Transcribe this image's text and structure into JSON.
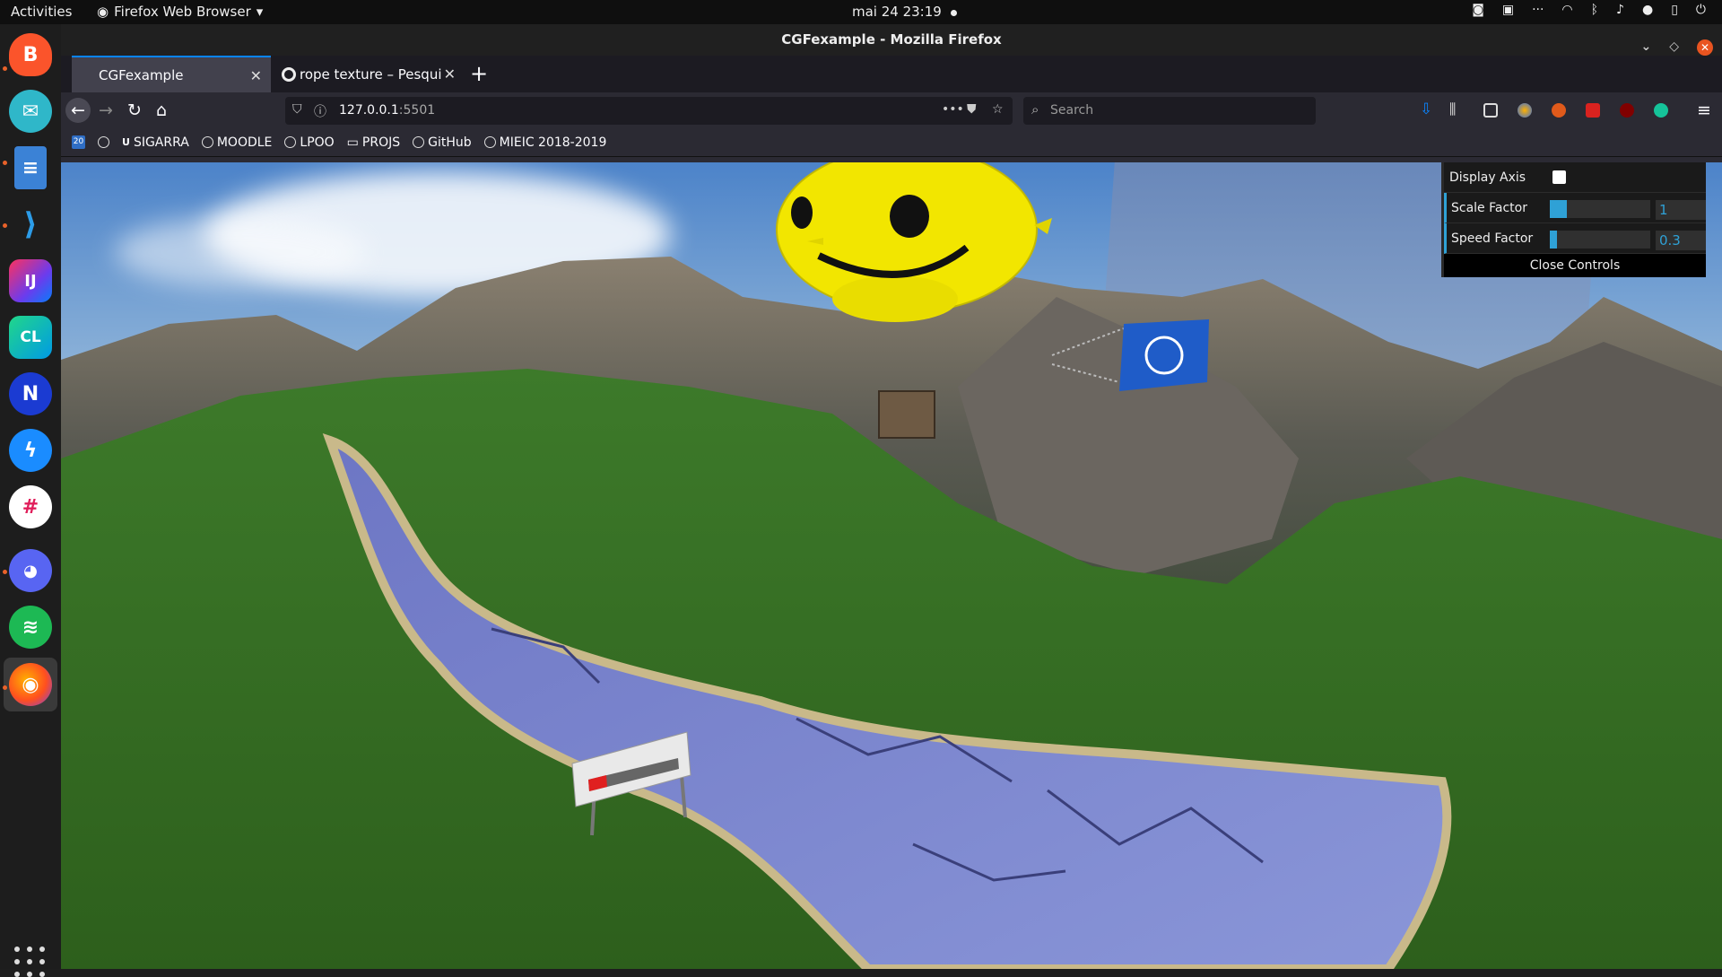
{
  "topbar": {
    "activities": "Activities",
    "app_menu": "Firefox Web Browser",
    "clock": "mai 24  23:19",
    "tray_more": "···"
  },
  "dock": {
    "items": [
      "brave-browser-beta",
      "mail",
      "text-editor",
      "vscode",
      "intellij-idea",
      "clion",
      "notion",
      "messenger",
      "slack",
      "discord",
      "spotify",
      "firefox"
    ],
    "show_apps": "show-applications"
  },
  "window": {
    "title": "CGFexample - Mozilla Firefox"
  },
  "tabs": [
    {
      "label": "CGFexample",
      "active": true
    },
    {
      "label": "rope texture – Pesquisa",
      "active": false
    }
  ],
  "navbar": {
    "url_host": "127.0.0.1",
    "url_port": ":5501",
    "url_more": "•••",
    "search_placeholder": "Search"
  },
  "bookmarks": [
    {
      "label": "",
      "icon": "calendar-icon",
      "badge": "20"
    },
    {
      "label": "",
      "icon": "globe-icon"
    },
    {
      "label": "SIGARRA",
      "icon": "uporto-icon"
    },
    {
      "label": "MOODLE",
      "icon": "globe-icon"
    },
    {
      "label": "LPOO",
      "icon": "globe-icon"
    },
    {
      "label": "PROJS",
      "icon": "folder-icon"
    },
    {
      "label": "GitHub",
      "icon": "github-icon"
    },
    {
      "label": "MIEIC 2018-2019",
      "icon": "globe-icon"
    }
  ],
  "controls": {
    "display_axis_label": "Display Axis",
    "display_axis_checked": false,
    "scale_factor_label": "Scale Factor",
    "scale_factor_value": "1",
    "scale_factor_fill": 0.17,
    "speed_factor_label": "Speed Factor",
    "speed_factor_value": "0.3",
    "speed_factor_fill": 0.07,
    "close_label": "Close Controls"
  },
  "colors": {
    "accent": "#2fa1d6",
    "tab_accent": "#0a84ff",
    "ubuntu_orange": "#e95420",
    "blimp_yellow": "#f2e600",
    "flag_blue": "#1f5cc8"
  }
}
